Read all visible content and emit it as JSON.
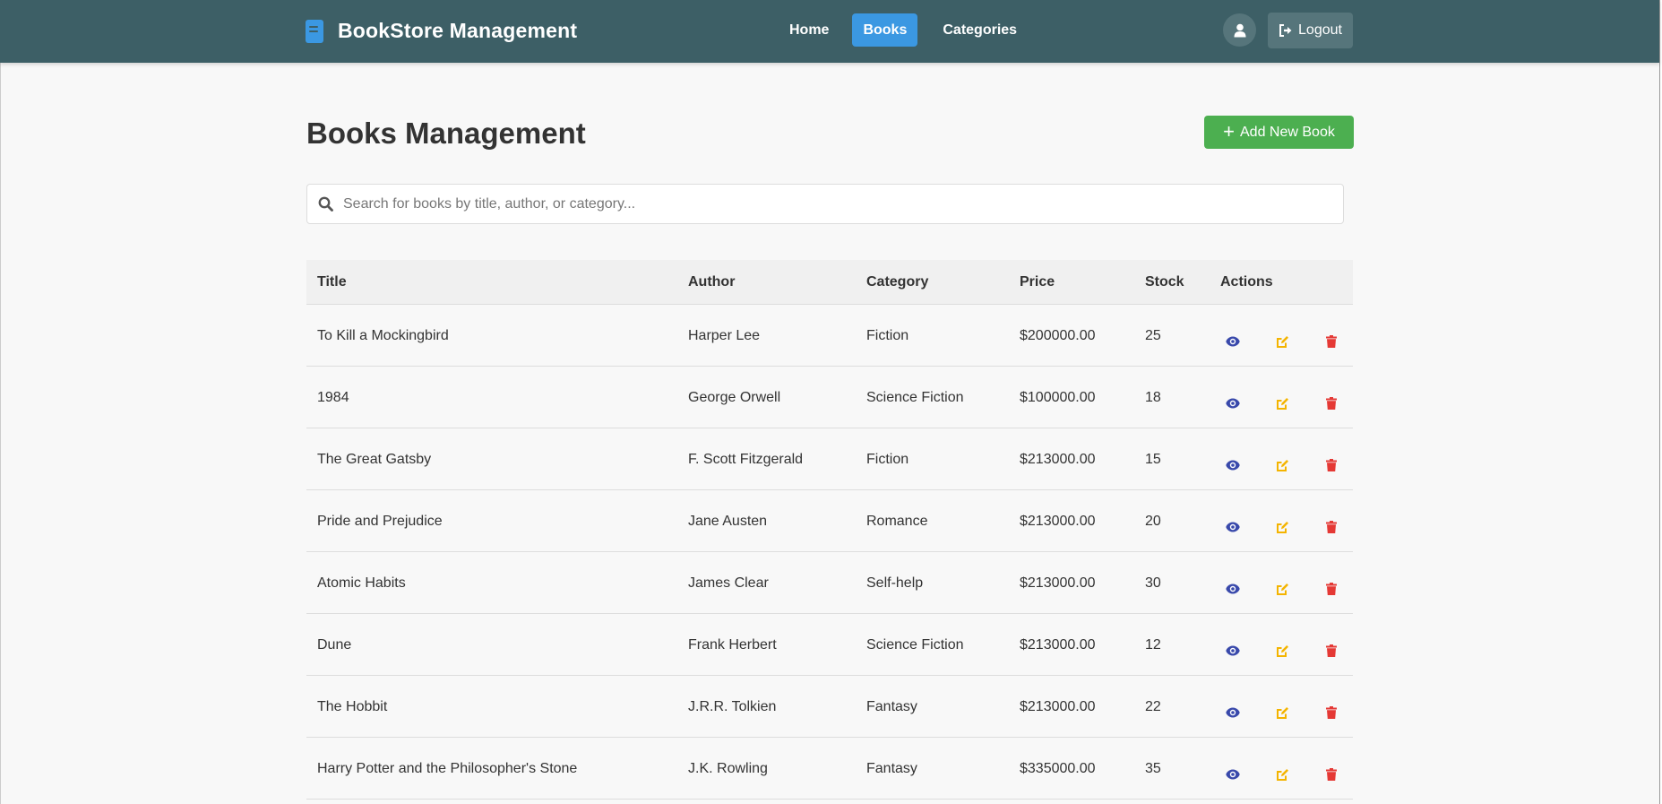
{
  "navbar": {
    "brand": "BookStore Management",
    "links": [
      {
        "label": "Home",
        "active": false
      },
      {
        "label": "Books",
        "active": true
      },
      {
        "label": "Categories",
        "active": false
      }
    ],
    "logout_label": "Logout"
  },
  "main": {
    "title": "Books Management",
    "add_button_label": "Add New Book",
    "search": {
      "placeholder": "Search for books by title, author, or category...",
      "value": ""
    }
  },
  "table": {
    "headers": [
      "Title",
      "Author",
      "Category",
      "Price",
      "Stock",
      "Actions"
    ],
    "rows": [
      {
        "title": "To Kill a Mockingbird",
        "author": "Harper Lee",
        "category": "Fiction",
        "price": "$200000.00",
        "stock": "25"
      },
      {
        "title": "1984",
        "author": "George Orwell",
        "category": "Science Fiction",
        "price": "$100000.00",
        "stock": "18"
      },
      {
        "title": "The Great Gatsby",
        "author": "F. Scott Fitzgerald",
        "category": "Fiction",
        "price": "$213000.00",
        "stock": "15"
      },
      {
        "title": "Pride and Prejudice",
        "author": "Jane Austen",
        "category": "Romance",
        "price": "$213000.00",
        "stock": "20"
      },
      {
        "title": "Atomic Habits",
        "author": "James Clear",
        "category": "Self-help",
        "price": "$213000.00",
        "stock": "30"
      },
      {
        "title": "Dune",
        "author": "Frank Herbert",
        "category": "Science Fiction",
        "price": "$213000.00",
        "stock": "12"
      },
      {
        "title": "The Hobbit",
        "author": "J.R.R. Tolkien",
        "category": "Fantasy",
        "price": "$213000.00",
        "stock": "22"
      },
      {
        "title": "Harry Potter and the Philosopher's Stone",
        "author": "J.K. Rowling",
        "category": "Fantasy",
        "price": "$335000.00",
        "stock": "35"
      }
    ],
    "action_icons": [
      "eye-icon",
      "edit-icon",
      "trash-icon"
    ]
  },
  "colors": {
    "navbar": "#3d5f66",
    "accent_blue": "#3b98e2",
    "add_green": "#4caf50",
    "view_icon": "#3949ab",
    "edit_icon": "#f4b400",
    "delete_icon": "#e53935"
  }
}
